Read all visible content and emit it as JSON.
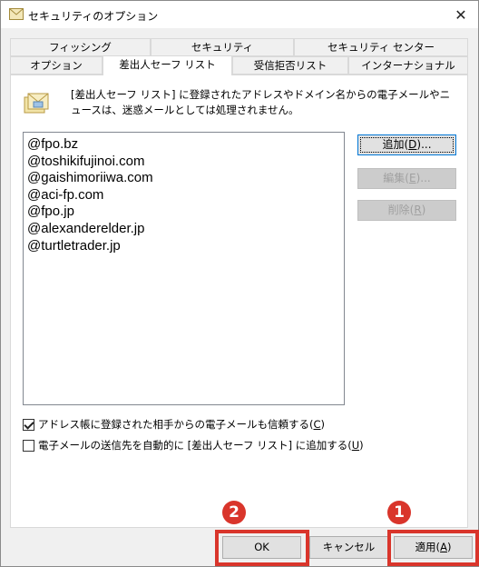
{
  "window": {
    "title": "セキュリティのオプション"
  },
  "tabs_back": [
    {
      "label": "フィッシング"
    },
    {
      "label": "セキュリティ"
    },
    {
      "label": "セキュリティ センター"
    }
  ],
  "tabs_front": [
    {
      "label": "オプション"
    },
    {
      "label": "差出人セーフ リスト"
    },
    {
      "label": "受信拒否リスト"
    },
    {
      "label": "インターナショナル"
    }
  ],
  "panel": {
    "description": "[差出人セーフ リスト] に登録されたアドレスやドメイン名からの電子メールやニュースは、迷惑メールとしては処理されません。",
    "list_items": [
      "@fpo.bz",
      "@toshikifujinoi.com",
      "@gaishimoriiwa.com",
      "@aci-fp.com",
      "@fpo.jp",
      "@alexanderelder.jp",
      "@turtletrader.jp"
    ],
    "buttons": {
      "add_label": "追加(",
      "add_key": "D",
      "add_suffix": ")...",
      "edit_label": "編集(",
      "edit_key": "E",
      "edit_suffix": ")...",
      "delete_label": "削除(",
      "delete_key": "R",
      "delete_suffix": ")"
    },
    "checkbox1": {
      "label": "アドレス帳に登録された相手からの電子メールも信頼する(",
      "key": "C",
      "suffix": ")",
      "checked": true
    },
    "checkbox2": {
      "label": "電子メールの送信先を自動的に [差出人セーフ リスト] に追加する(",
      "key": "U",
      "suffix": ")",
      "checked": false
    }
  },
  "footer": {
    "ok_label": "OK",
    "cancel_label": "キャンセル",
    "apply_label": "適用(",
    "apply_key": "A",
    "apply_suffix": ")"
  },
  "annotations": {
    "badge_ok": "2",
    "badge_apply": "1",
    "color": "#d9352b"
  }
}
